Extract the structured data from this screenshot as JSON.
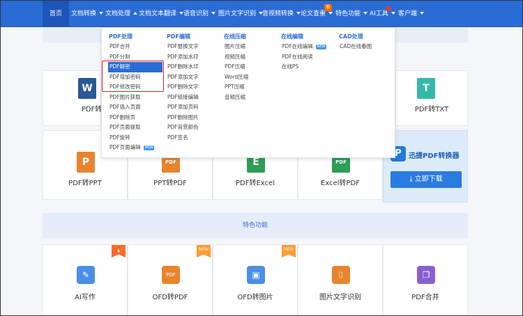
{
  "nav": {
    "items": [
      {
        "label": "首页",
        "caret": ""
      },
      {
        "label": "文档转换",
        "caret": "down"
      },
      {
        "label": "文档处理",
        "caret": "up"
      },
      {
        "label": "文档文本翻译",
        "caret": "down"
      },
      {
        "label": "语音识别",
        "caret": "down"
      },
      {
        "label": "图片文字识别",
        "caret": "down"
      },
      {
        "label": "音视频转换",
        "caret": "down"
      },
      {
        "label": "论文查重",
        "caret": "down"
      },
      {
        "label": "特色功能",
        "caret": "down"
      },
      {
        "label": "AI工具",
        "caret": "down"
      },
      {
        "label": "客户端",
        "caret": "down"
      }
    ],
    "badge_new": "新"
  },
  "dropdown": {
    "columns": [
      {
        "head": "PDF处理",
        "items": [
          "PDF合并",
          "PDF分割",
          "PDF解密",
          "PDF增加密码",
          "PDF修改密码",
          "PDF图片获取",
          "PDF插入页面",
          "PDF删除页",
          "PDF页面提取",
          "PDF旋转",
          "PDF页面编辑"
        ]
      },
      {
        "head": "PDF编辑",
        "items": [
          "PDF替换文字",
          "PDF添加水印",
          "PDF删除水印",
          "PDF添加文字",
          "PDF删除文字",
          "PDF链接编辑",
          "PDF添加页码",
          "PDF删除图片",
          "PDF背景颜色",
          "PDF签名"
        ]
      },
      {
        "head": "在线压缩",
        "items": [
          "图片压缩",
          "视频压缩",
          "PDF压缩",
          "Word压缩",
          "PPT压缩",
          "音频压缩"
        ]
      },
      {
        "head": "在线编辑",
        "items": [
          "PDF在线编辑",
          "PDF在线阅读",
          "在线PS"
        ]
      },
      {
        "head": "CAD处理",
        "items": [
          "CAD在线看图"
        ]
      }
    ],
    "new_tag": "NEW",
    "selected_item": "PDF解密"
  },
  "cards_row1": [
    {
      "label": "PDF转Word",
      "icon": "W",
      "color": "#2b5797"
    },
    {
      "label": "PDF转TXT",
      "icon": "T",
      "color": "#35b8a9"
    }
  ],
  "cards_row2": [
    {
      "label": "PDF转PPT",
      "icon": "P",
      "color": "#e8842e"
    },
    {
      "label": "PPT转PDF",
      "icon": "PDF",
      "color": "#e8842e"
    },
    {
      "label": "PDF转Excel",
      "icon": "E",
      "color": "#2e9d56"
    },
    {
      "label": "Excel转PDF",
      "icon": "PDF",
      "color": "#2e9d56"
    }
  ],
  "promo": {
    "title": "迅捷PDF转换器",
    "logo": "P",
    "button": "立即下载"
  },
  "feature_heading": "特色功能",
  "cards_row3": [
    {
      "label": "AI写作",
      "tag": "🔥",
      "icon": "✎",
      "color": "#4a8ee6"
    },
    {
      "label": "OFD转PDF",
      "tag": "NEW",
      "icon": "PDF",
      "color": "#e8842e"
    },
    {
      "label": "OFD转图片",
      "tag": "NEW",
      "icon": "▣",
      "color": "#4a8ee6"
    },
    {
      "label": "图片文字识别",
      "tag": "",
      "icon": "⌷",
      "color": "#e8842e"
    },
    {
      "label": "PDF合并",
      "tag": "",
      "icon": "❐",
      "color": "#8a5fd0"
    }
  ]
}
